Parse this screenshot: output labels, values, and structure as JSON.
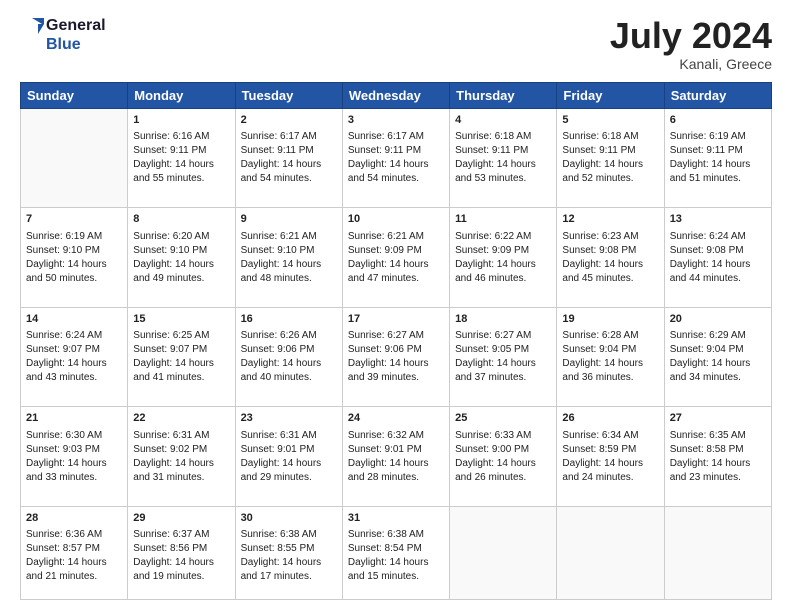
{
  "header": {
    "logo_line1": "General",
    "logo_line2": "Blue",
    "month_year": "July 2024",
    "location": "Kanali, Greece"
  },
  "days_of_week": [
    "Sunday",
    "Monday",
    "Tuesday",
    "Wednesday",
    "Thursday",
    "Friday",
    "Saturday"
  ],
  "weeks": [
    [
      {
        "day": "",
        "content": ""
      },
      {
        "day": "1",
        "content": "Sunrise: 6:16 AM\nSunset: 9:11 PM\nDaylight: 14 hours\nand 55 minutes."
      },
      {
        "day": "2",
        "content": "Sunrise: 6:17 AM\nSunset: 9:11 PM\nDaylight: 14 hours\nand 54 minutes."
      },
      {
        "day": "3",
        "content": "Sunrise: 6:17 AM\nSunset: 9:11 PM\nDaylight: 14 hours\nand 54 minutes."
      },
      {
        "day": "4",
        "content": "Sunrise: 6:18 AM\nSunset: 9:11 PM\nDaylight: 14 hours\nand 53 minutes."
      },
      {
        "day": "5",
        "content": "Sunrise: 6:18 AM\nSunset: 9:11 PM\nDaylight: 14 hours\nand 52 minutes."
      },
      {
        "day": "6",
        "content": "Sunrise: 6:19 AM\nSunset: 9:11 PM\nDaylight: 14 hours\nand 51 minutes."
      }
    ],
    [
      {
        "day": "7",
        "content": "Sunrise: 6:19 AM\nSunset: 9:10 PM\nDaylight: 14 hours\nand 50 minutes."
      },
      {
        "day": "8",
        "content": "Sunrise: 6:20 AM\nSunset: 9:10 PM\nDaylight: 14 hours\nand 49 minutes."
      },
      {
        "day": "9",
        "content": "Sunrise: 6:21 AM\nSunset: 9:10 PM\nDaylight: 14 hours\nand 48 minutes."
      },
      {
        "day": "10",
        "content": "Sunrise: 6:21 AM\nSunset: 9:09 PM\nDaylight: 14 hours\nand 47 minutes."
      },
      {
        "day": "11",
        "content": "Sunrise: 6:22 AM\nSunset: 9:09 PM\nDaylight: 14 hours\nand 46 minutes."
      },
      {
        "day": "12",
        "content": "Sunrise: 6:23 AM\nSunset: 9:08 PM\nDaylight: 14 hours\nand 45 minutes."
      },
      {
        "day": "13",
        "content": "Sunrise: 6:24 AM\nSunset: 9:08 PM\nDaylight: 14 hours\nand 44 minutes."
      }
    ],
    [
      {
        "day": "14",
        "content": "Sunrise: 6:24 AM\nSunset: 9:07 PM\nDaylight: 14 hours\nand 43 minutes."
      },
      {
        "day": "15",
        "content": "Sunrise: 6:25 AM\nSunset: 9:07 PM\nDaylight: 14 hours\nand 41 minutes."
      },
      {
        "day": "16",
        "content": "Sunrise: 6:26 AM\nSunset: 9:06 PM\nDaylight: 14 hours\nand 40 minutes."
      },
      {
        "day": "17",
        "content": "Sunrise: 6:27 AM\nSunset: 9:06 PM\nDaylight: 14 hours\nand 39 minutes."
      },
      {
        "day": "18",
        "content": "Sunrise: 6:27 AM\nSunset: 9:05 PM\nDaylight: 14 hours\nand 37 minutes."
      },
      {
        "day": "19",
        "content": "Sunrise: 6:28 AM\nSunset: 9:04 PM\nDaylight: 14 hours\nand 36 minutes."
      },
      {
        "day": "20",
        "content": "Sunrise: 6:29 AM\nSunset: 9:04 PM\nDaylight: 14 hours\nand 34 minutes."
      }
    ],
    [
      {
        "day": "21",
        "content": "Sunrise: 6:30 AM\nSunset: 9:03 PM\nDaylight: 14 hours\nand 33 minutes."
      },
      {
        "day": "22",
        "content": "Sunrise: 6:31 AM\nSunset: 9:02 PM\nDaylight: 14 hours\nand 31 minutes."
      },
      {
        "day": "23",
        "content": "Sunrise: 6:31 AM\nSunset: 9:01 PM\nDaylight: 14 hours\nand 29 minutes."
      },
      {
        "day": "24",
        "content": "Sunrise: 6:32 AM\nSunset: 9:01 PM\nDaylight: 14 hours\nand 28 minutes."
      },
      {
        "day": "25",
        "content": "Sunrise: 6:33 AM\nSunset: 9:00 PM\nDaylight: 14 hours\nand 26 minutes."
      },
      {
        "day": "26",
        "content": "Sunrise: 6:34 AM\nSunset: 8:59 PM\nDaylight: 14 hours\nand 24 minutes."
      },
      {
        "day": "27",
        "content": "Sunrise: 6:35 AM\nSunset: 8:58 PM\nDaylight: 14 hours\nand 23 minutes."
      }
    ],
    [
      {
        "day": "28",
        "content": "Sunrise: 6:36 AM\nSunset: 8:57 PM\nDaylight: 14 hours\nand 21 minutes."
      },
      {
        "day": "29",
        "content": "Sunrise: 6:37 AM\nSunset: 8:56 PM\nDaylight: 14 hours\nand 19 minutes."
      },
      {
        "day": "30",
        "content": "Sunrise: 6:38 AM\nSunset: 8:55 PM\nDaylight: 14 hours\nand 17 minutes."
      },
      {
        "day": "31",
        "content": "Sunrise: 6:38 AM\nSunset: 8:54 PM\nDaylight: 14 hours\nand 15 minutes."
      },
      {
        "day": "",
        "content": ""
      },
      {
        "day": "",
        "content": ""
      },
      {
        "day": "",
        "content": ""
      }
    ]
  ]
}
